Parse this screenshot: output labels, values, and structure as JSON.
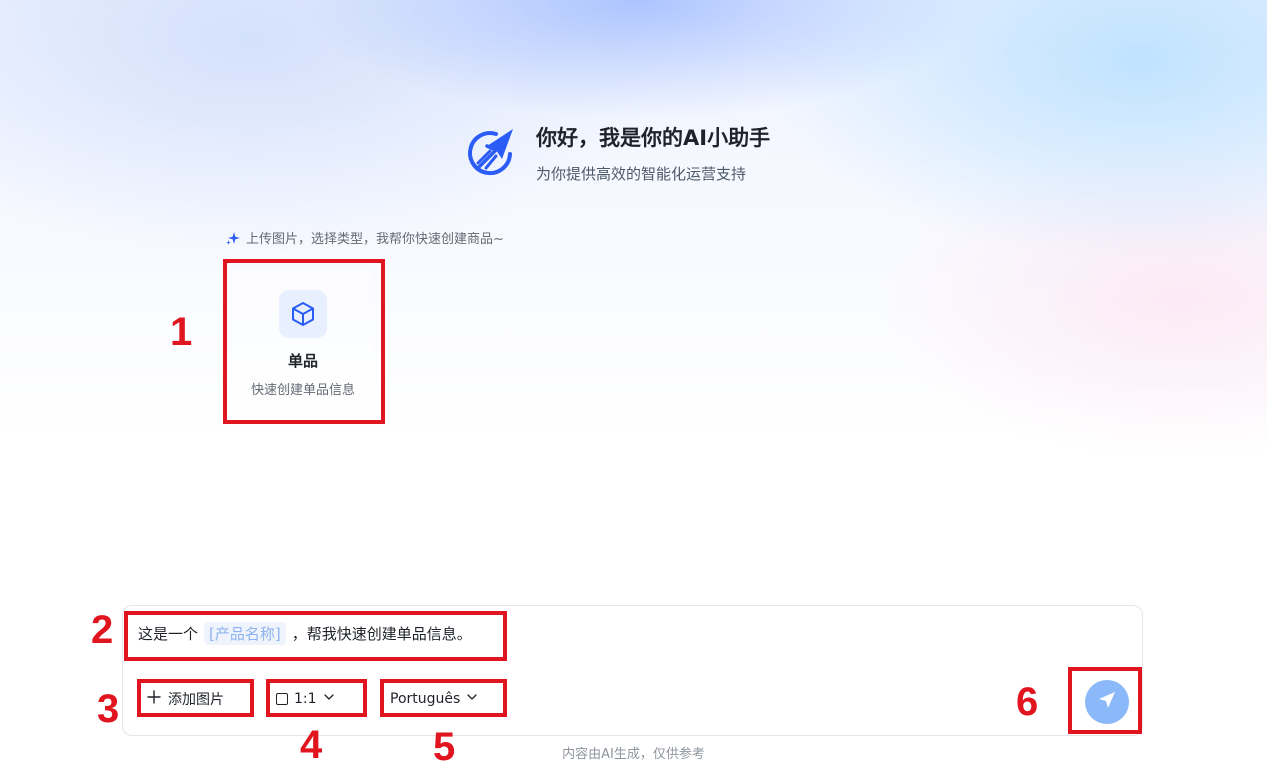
{
  "header": {
    "title": "你好，我是你的AI小助手",
    "subtitle": "为你提供高效的智能化运营支持"
  },
  "hint": {
    "text": "上传图片，选择类型，我帮你快速创建商品~"
  },
  "card": {
    "title": "单品",
    "description": "快速创建单品信息",
    "icon": "cube-icon"
  },
  "composer": {
    "prompt_prefix": "这是一个",
    "prompt_slot": "[产品名称]",
    "prompt_suffix": "，帮我快速创建单品信息。",
    "add_image_label": "添加图片",
    "aspect_ratio": "1:1",
    "language": "Português"
  },
  "footer": {
    "note": "内容由AI生成，仅供参考"
  },
  "annotations": [
    "1",
    "2",
    "3",
    "4",
    "5",
    "6"
  ],
  "colors": {
    "accent": "#2b5cf6",
    "annotation": "#e0151f",
    "send_button": "#8bb8f8",
    "slot_text": "#8fb3f0"
  }
}
